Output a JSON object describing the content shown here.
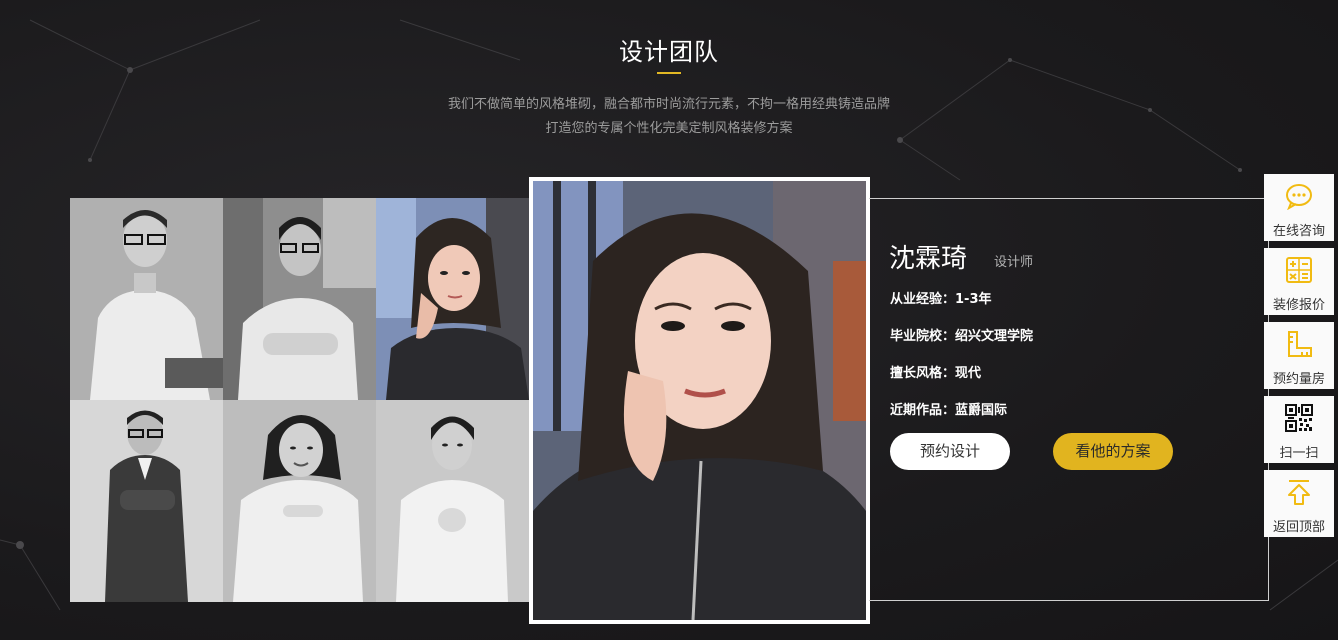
{
  "section": {
    "title": "设计团队",
    "desc_line1": "我们不做简单的风格堆砌，融合都市时尚流行元素，不拘一格用经典铸造品牌",
    "desc_line2": "打造您的专属个性化完美定制风格装修方案"
  },
  "designer": {
    "name": "沈霖琦",
    "role": "设计师",
    "experience": "从业经验：1-3年",
    "school": "毕业院校：绍兴文理学院",
    "style": "擅长风格：现代",
    "recent_work": "近期作品：蓝爵国际"
  },
  "buttons": {
    "book": "预约设计",
    "cases": "看他的方案"
  },
  "sidebar": {
    "items": [
      {
        "label": "在线咨询",
        "icon": "chat-icon"
      },
      {
        "label": "装修报价",
        "icon": "calculator-icon"
      },
      {
        "label": "预约量房",
        "icon": "ruler-icon"
      },
      {
        "label": "扫一扫",
        "icon": "qr-code-icon"
      },
      {
        "label": "返回顶部",
        "icon": "back-to-top-icon"
      }
    ]
  },
  "colors": {
    "accent": "#e1b41f",
    "background": "#1c1b1d",
    "icon": "#f1bb12"
  }
}
